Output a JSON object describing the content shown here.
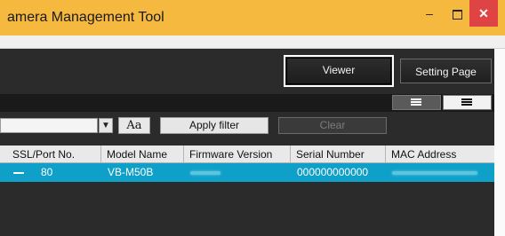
{
  "window": {
    "title": "amera Management Tool",
    "minimize_glyph": "–",
    "close_glyph": "✕"
  },
  "toolbar": {
    "viewer_label": "Viewer",
    "setting_label": "Setting Page"
  },
  "filter": {
    "input_value": "",
    "dropdown_glyph": "▼",
    "case_label": "Aa",
    "apply_label": "Apply filter",
    "clear_label": "Clear"
  },
  "table": {
    "columns": [
      "SSL/Port No.",
      "Model Name",
      "Firmware Version",
      "Serial Number",
      "MAC Address"
    ],
    "rows": [
      {
        "port": "80",
        "model": "VB-M50B",
        "serial": "000000000000"
      }
    ]
  },
  "colors": {
    "title_bar": "#f6b940",
    "selected_row": "#0ea0c8",
    "close_button": "#e04343"
  },
  "icons": [
    "minimize-icon",
    "maximize-icon",
    "close-icon",
    "dropdown-arrow-icon",
    "list-view-icon",
    "detail-view-icon"
  ]
}
